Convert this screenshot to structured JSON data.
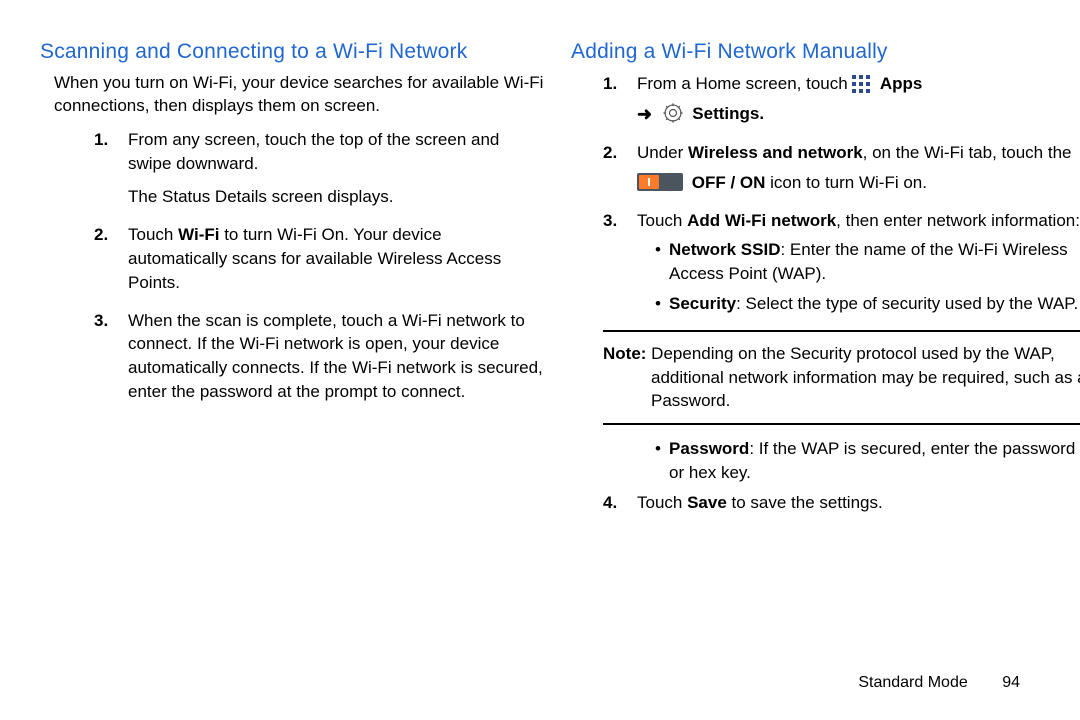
{
  "left": {
    "heading": "Scanning and Connecting to a Wi-Fi Network",
    "intro": "When you turn on Wi-Fi, your device searches for available Wi-Fi connections, then displays them on screen.",
    "steps": {
      "s1_num": "1.",
      "s1a": "From any screen, touch the top of the screen and swipe downward.",
      "s1b": "The Status Details screen displays.",
      "s2_num": "2.",
      "s2a_pre": "Touch ",
      "s2a_b": "Wi-Fi",
      "s2a_post": " to turn Wi-Fi On. Your device automatically scans for available Wireless Access Points.",
      "s3_num": "3.",
      "s3": "When the scan is complete, touch a Wi-Fi network to connect. If the Wi-Fi network is open, your device automatically connects. If the Wi-Fi network is secured, enter the password at the prompt to connect."
    }
  },
  "right": {
    "heading": "Adding a Wi-Fi Network Manually",
    "steps": {
      "s1_num": "1.",
      "s1_pre": "From a Home screen, touch ",
      "s1_apps": "Apps",
      "s1_arrow": "➜",
      "s1_settings": "Settings.",
      "s2_num": "2.",
      "s2_pre": "Under ",
      "s2_b1": "Wireless and network",
      "s2_mid": ", on the Wi-Fi tab, touch the",
      "s2_b2": "OFF / ON",
      "s2_post": " icon to turn Wi-Fi on.",
      "s3_num": "3.",
      "s3_pre": "Touch ",
      "s3_b": "Add Wi-Fi network",
      "s3_post": ", then enter network information:",
      "bullets": {
        "b1_b": "Network SSID",
        "b1_rest": ": Enter the name of the Wi-Fi Wireless Access Point (WAP).",
        "b2_b": "Security",
        "b2_rest": ": Select the type of security used by the WAP."
      },
      "note_b": "Note:",
      "note_rest": " Depending on the Security protocol used by the WAP, additional network information may be required, such as a Password.",
      "b3_b": "Password",
      "b3_rest": ": If the WAP is secured, enter the password or hex key.",
      "s4_num": "4.",
      "s4_pre": "Touch ",
      "s4_b": "Save",
      "s4_post": " to save the settings."
    }
  },
  "footer": {
    "section": "Standard Mode",
    "page": "94"
  }
}
